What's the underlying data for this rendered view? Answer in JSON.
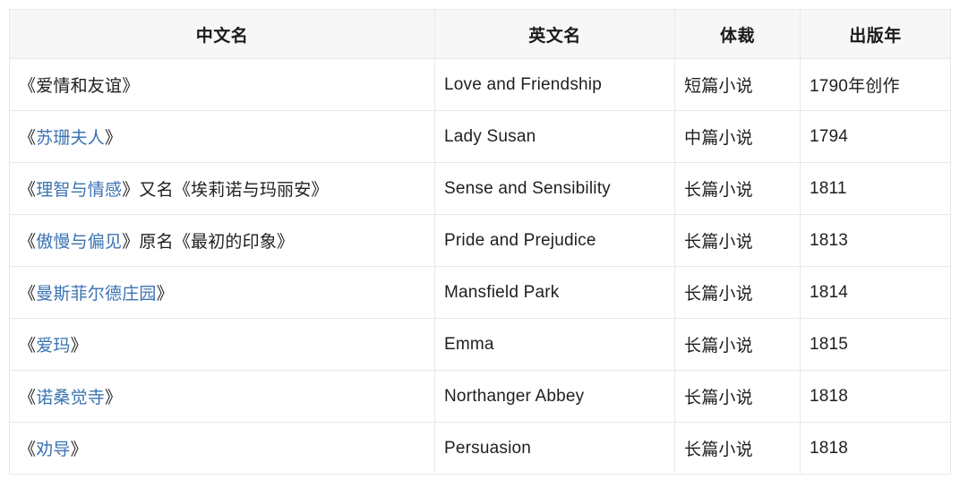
{
  "table": {
    "columns": [
      {
        "key": "chinese_title",
        "label": "中文名"
      },
      {
        "key": "english_title",
        "label": "英文名"
      },
      {
        "key": "genre",
        "label": "体裁"
      },
      {
        "key": "publication_year",
        "label": "出版年"
      }
    ],
    "link_color": "#3b73b2",
    "text_color": "#1f1f1f",
    "header_background": "#f7f7f7",
    "border_color": "#e8e8e8",
    "rows": [
      {
        "chinese_title": "《爱情和友谊》",
        "chinese_title_open_bracket": "《",
        "chinese_title_link": "爱情和友谊",
        "chinese_title_close_bracket": "》",
        "chinese_title_suffix": "",
        "chinese_title_is_link": false,
        "english_title": "Love and Friendship",
        "genre": "短篇小说",
        "publication_year": "1790年创作"
      },
      {
        "chinese_title": "《苏珊夫人》",
        "chinese_title_open_bracket": "《",
        "chinese_title_link": "苏珊夫人",
        "chinese_title_close_bracket": "》",
        "chinese_title_suffix": "",
        "chinese_title_is_link": true,
        "english_title": "Lady Susan",
        "genre": "中篇小说",
        "publication_year": "1794"
      },
      {
        "chinese_title": "《理智与情感》又名《埃莉诺与玛丽安》",
        "chinese_title_open_bracket": "《",
        "chinese_title_link": "理智与情感",
        "chinese_title_close_bracket": "》",
        "chinese_title_suffix": "又名《埃莉诺与玛丽安》",
        "chinese_title_is_link": true,
        "english_title": "Sense and Sensibility",
        "genre": "长篇小说",
        "publication_year": "1811"
      },
      {
        "chinese_title": "《傲慢与偏见》原名《最初的印象》",
        "chinese_title_open_bracket": "《",
        "chinese_title_link": "傲慢与偏见",
        "chinese_title_close_bracket": "》",
        "chinese_title_suffix": "原名《最初的印象》",
        "chinese_title_is_link": true,
        "english_title": "Pride and Prejudice",
        "genre": "长篇小说",
        "publication_year": "1813"
      },
      {
        "chinese_title": "《曼斯菲尔德庄园》",
        "chinese_title_open_bracket": "《",
        "chinese_title_link": "曼斯菲尔德庄园",
        "chinese_title_close_bracket": "》",
        "chinese_title_suffix": "",
        "chinese_title_is_link": true,
        "english_title": "Mansfield Park",
        "genre": "长篇小说",
        "publication_year": "1814"
      },
      {
        "chinese_title": "《爱玛》",
        "chinese_title_open_bracket": "《",
        "chinese_title_link": "爱玛",
        "chinese_title_close_bracket": "》",
        "chinese_title_suffix": "",
        "chinese_title_is_link": true,
        "english_title": "Emma",
        "genre": "长篇小说",
        "publication_year": "1815"
      },
      {
        "chinese_title": "《诺桑觉寺》",
        "chinese_title_open_bracket": "《",
        "chinese_title_link": "诺桑觉寺",
        "chinese_title_close_bracket": "》",
        "chinese_title_suffix": "",
        "chinese_title_is_link": true,
        "english_title": "Northanger Abbey",
        "genre": "长篇小说",
        "publication_year": "1818"
      },
      {
        "chinese_title": "《劝导》",
        "chinese_title_open_bracket": "《",
        "chinese_title_link": "劝导",
        "chinese_title_close_bracket": "》",
        "chinese_title_suffix": "",
        "chinese_title_is_link": true,
        "english_title": "Persuasion",
        "genre": "长篇小说",
        "publication_year": "1818"
      }
    ]
  }
}
